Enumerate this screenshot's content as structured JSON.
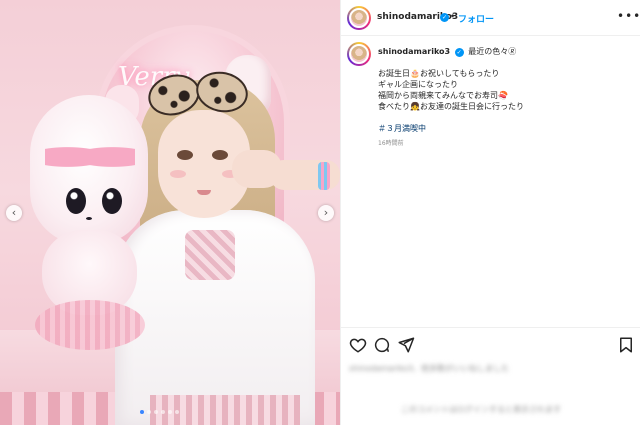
{
  "post": {
    "username": "shinodamariko3",
    "separator": "•",
    "follow_label": "フォロー",
    "more_icon": "more-horizontal-icon"
  },
  "caption": {
    "username": "shinodamariko3",
    "first_line": "最近の色々🄬",
    "lines": [
      "お誕生日🎂お祝いしてもらったり",
      "ギャル企画になったり",
      "福岡から両親来てみんなでお寿司🍣",
      "食べたり👧お友達の誕生日会に行ったり"
    ],
    "hashtag": "＃３月満喫中",
    "time": "16時間前"
  },
  "carousel": {
    "prev_glyph": "‹",
    "next_glyph": "›",
    "dot_count": 6,
    "active_index": 0
  },
  "photo": {
    "neon_text": "Verry"
  },
  "actions": {
    "icons": [
      "heart-icon",
      "comment-icon",
      "share-icon",
      "bookmark-icon"
    ]
  },
  "blurred": {
    "likes_text": "shinodamariko3、他多数がいいねしました",
    "comment_placeholder": "このコメントはログインすると表示されます"
  },
  "colors": {
    "link_blue": "#0095f6",
    "hashtag_blue": "#00376b"
  }
}
